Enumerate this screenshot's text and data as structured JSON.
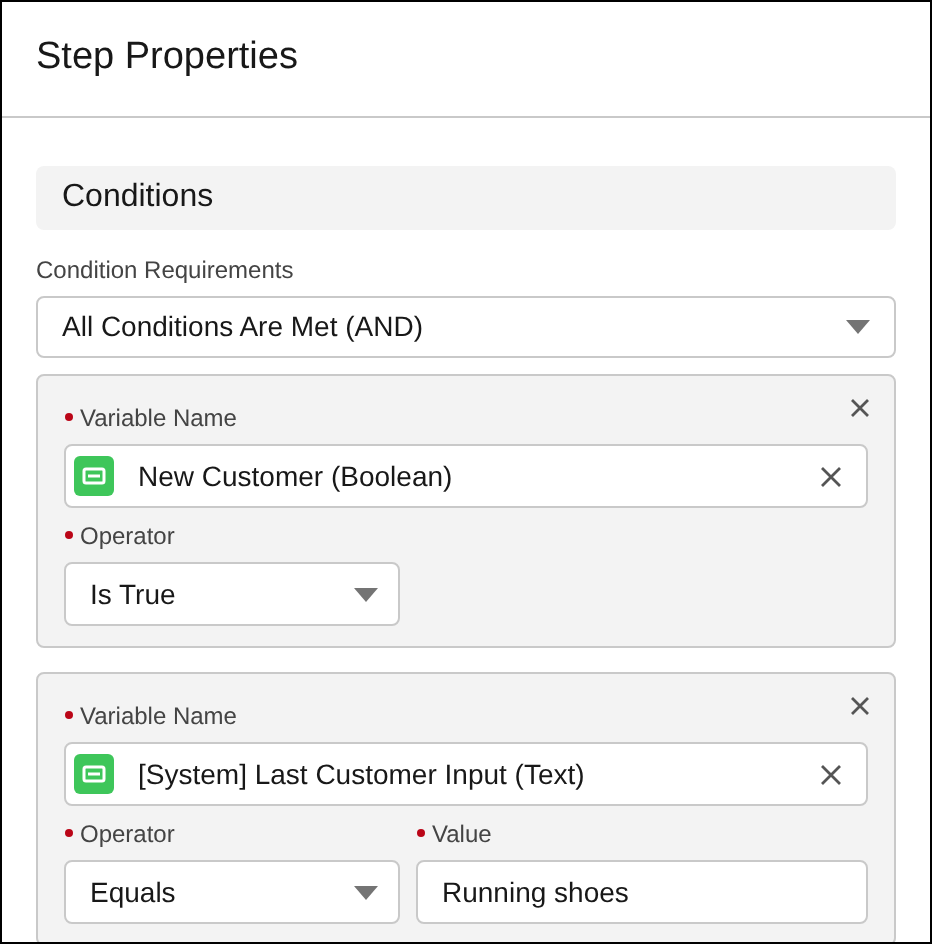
{
  "panel": {
    "title": "Step Properties"
  },
  "section": {
    "title": "Conditions"
  },
  "requirements": {
    "label": "Condition Requirements",
    "value": "All Conditions Are Met (AND)"
  },
  "conditions": [
    {
      "variable": {
        "label": "Variable Name",
        "required": true,
        "value": "New Customer (Boolean)"
      },
      "operator": {
        "label": "Operator",
        "required": true,
        "value": "Is True"
      }
    },
    {
      "variable": {
        "label": "Variable Name",
        "required": true,
        "value": "[System] Last Customer Input (Text)"
      },
      "operator": {
        "label": "Operator",
        "required": true,
        "value": "Equals"
      },
      "value": {
        "label": "Value",
        "required": true,
        "value": "Running shoes"
      }
    }
  ]
}
